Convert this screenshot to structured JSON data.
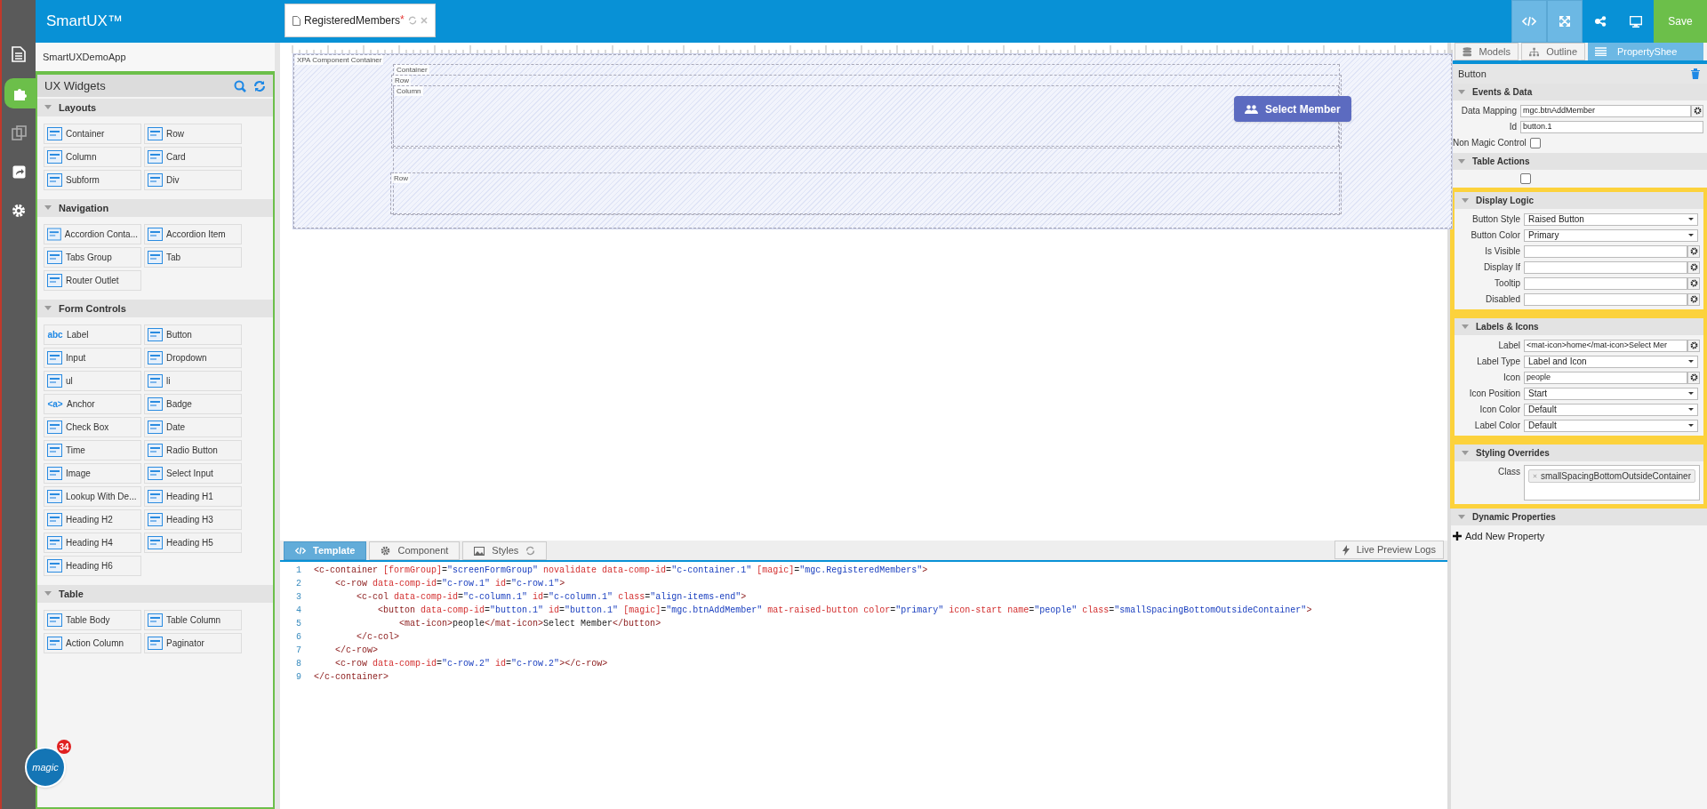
{
  "app": {
    "title": "SmartUX™",
    "project": "SmartUXDemoApp",
    "logo_text": "magic",
    "notification_count": "34"
  },
  "rail": [
    {
      "kind": "document",
      "selected": false
    },
    {
      "kind": "puzzle",
      "selected": true
    },
    {
      "kind": "copy",
      "selected": false
    },
    {
      "kind": "share",
      "selected": false
    },
    {
      "kind": "gear",
      "selected": false
    }
  ],
  "toolbar": {
    "buttons": [
      {
        "kind": "code",
        "active": true
      },
      {
        "kind": "expand",
        "active": true
      },
      {
        "kind": "nodes",
        "active": false
      },
      {
        "kind": "monitor",
        "active": false
      }
    ],
    "save": "Save"
  },
  "widgets": {
    "title": "UX Widgets",
    "groups": [
      {
        "name": "Layouts",
        "items": [
          {
            "label": "Container"
          },
          {
            "label": "Row"
          },
          {
            "label": "Column"
          },
          {
            "label": "Card"
          },
          {
            "label": "Subform"
          },
          {
            "label": "Div"
          }
        ]
      },
      {
        "name": "Navigation",
        "items": [
          {
            "label": "Accordion Conta..."
          },
          {
            "label": "Accordion Item"
          },
          {
            "label": "Tabs Group"
          },
          {
            "label": "Tab"
          },
          {
            "label": "Router Outlet"
          }
        ]
      },
      {
        "name": "Form Controls",
        "items": [
          {
            "label": "Label",
            "icon_text": "abc"
          },
          {
            "label": "Button"
          },
          {
            "label": "Input"
          },
          {
            "label": "Dropdown"
          },
          {
            "label": "ul"
          },
          {
            "label": "li"
          },
          {
            "label": "Anchor",
            "icon_text": "<a>"
          },
          {
            "label": "Badge"
          },
          {
            "label": "Check Box"
          },
          {
            "label": "Date"
          },
          {
            "label": "Time"
          },
          {
            "label": "Radio Button"
          },
          {
            "label": "Image"
          },
          {
            "label": "Select Input"
          },
          {
            "label": "Lookup With De..."
          },
          {
            "label": "Heading H1"
          },
          {
            "label": "Heading H2"
          },
          {
            "label": "Heading H3"
          },
          {
            "label": "Heading H4"
          },
          {
            "label": "Heading H5"
          },
          {
            "label": "Heading H6"
          }
        ]
      },
      {
        "name": "Table",
        "items": [
          {
            "label": "Table Body"
          },
          {
            "label": "Table Column"
          },
          {
            "label": "Action Column"
          },
          {
            "label": "Paginator"
          }
        ]
      }
    ]
  },
  "editor_tab": {
    "label": "RegisteredMembers",
    "modified_mark": "*"
  },
  "canvas": {
    "frames": [
      "XPA Component Container",
      "Container",
      "Row",
      "Column",
      "Row"
    ],
    "button": "Select Member"
  },
  "code_panel": {
    "tabs": [
      {
        "label": "Template",
        "selected": true
      },
      {
        "label": "Component",
        "selected": false
      },
      {
        "label": "Styles",
        "selected": false
      }
    ],
    "logs": "Live Preview Logs",
    "lines": [
      {
        "number": "1",
        "text": "<c-container [formGroup]=\"screenFormGroup\" novalidate data-comp-id=\"c-container.1\" [magic]=\"mgc.RegisteredMembers\">"
      },
      {
        "number": "2",
        "text": "    <c-row data-comp-id=\"c-row.1\" id=\"c-row.1\">"
      },
      {
        "number": "3",
        "text": "        <c-col data-comp-id=\"c-column.1\" id=\"c-column.1\" class=\"align-items-end\">"
      },
      {
        "number": "4",
        "text": "            <button data-comp-id=\"button.1\" id=\"button.1\" [magic]=\"mgc.btnAddMember\" mat-raised-button color=\"primary\" icon-start name=\"people\" class=\"smallSpacingBottomOutsideContainer\">"
      },
      {
        "number": "5",
        "text": "                <mat-icon>people</mat-icon>Select Member</button>"
      },
      {
        "number": "6",
        "text": "        </c-col>"
      },
      {
        "number": "7",
        "text": "    </c-row>"
      },
      {
        "number": "8",
        "text": "    <c-row data-comp-id=\"c-row.2\" id=\"c-row.2\"></c-row>"
      },
      {
        "number": "9",
        "text": "</c-container>"
      }
    ]
  },
  "properties": {
    "tabs": [
      {
        "label": "Models",
        "selected": false
      },
      {
        "label": "Outline",
        "selected": false
      },
      {
        "label": "PropertyShee",
        "selected": true
      }
    ],
    "component": "Button",
    "sections": [
      {
        "title": "Events & Data",
        "highlighted": false,
        "rows": [
          {
            "kind": "input",
            "label": "Data Mapping",
            "value": "mgc.btnAddMember",
            "gear": true
          },
          {
            "kind": "input",
            "label": "Id",
            "value": "button.1",
            "gear": false
          },
          {
            "kind": "checkbox",
            "label": "Non Magic Control",
            "checked": false
          }
        ]
      },
      {
        "title": "Table Actions",
        "highlighted": false,
        "rows": [
          {
            "kind": "checkbox",
            "checked": false
          }
        ]
      },
      {
        "title": "Display Logic",
        "highlighted": true,
        "rows": [
          {
            "kind": "select",
            "label": "Button Style",
            "value": "Raised Button"
          },
          {
            "kind": "select",
            "label": "Button Color",
            "value": "Primary"
          },
          {
            "kind": "input",
            "label": "Is Visible",
            "gear": true
          },
          {
            "kind": "input",
            "label": "Display If",
            "gear": true
          },
          {
            "kind": "input",
            "label": "Tooltip",
            "gear": true
          },
          {
            "kind": "input",
            "label": "Disabled",
            "gear": true
          }
        ]
      },
      {
        "title": "Labels & Icons",
        "highlighted": true,
        "rows": [
          {
            "kind": "input",
            "label": "Label",
            "value": "<mat-icon>home</mat-icon>Select Mer",
            "gear": true
          },
          {
            "kind": "select",
            "label": "Label Type",
            "value": "Label and Icon"
          },
          {
            "kind": "input",
            "label": "Icon",
            "value": "people",
            "gear": true
          },
          {
            "kind": "select",
            "label": "Icon Position",
            "value": "Start"
          },
          {
            "kind": "select",
            "label": "Icon Color",
            "value": "Default"
          },
          {
            "kind": "select",
            "label": "Label Color",
            "value": "Default"
          }
        ]
      },
      {
        "title": "Styling Overrides",
        "highlighted": true,
        "rows": [
          {
            "kind": "tags",
            "label": "Class",
            "tags": [
              "smallSpacingBottomOutsideContainer"
            ]
          }
        ]
      },
      {
        "title": "Dynamic Properties",
        "highlighted": false,
        "rows": [
          {
            "kind": "action",
            "label": "Add New Property"
          }
        ]
      }
    ]
  }
}
